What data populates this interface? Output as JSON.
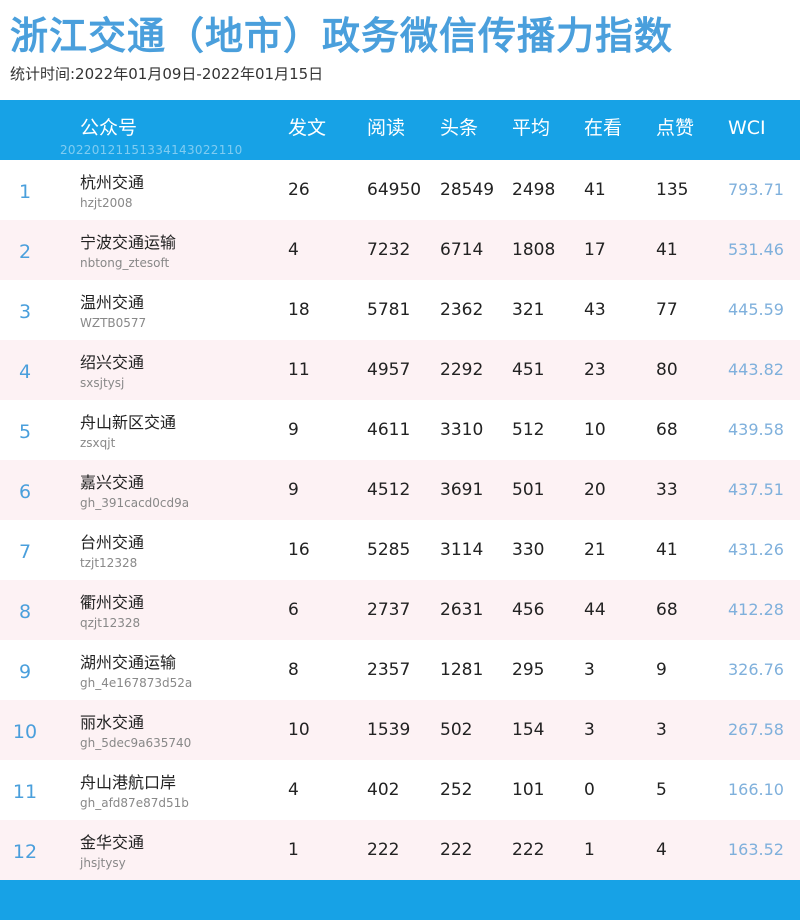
{
  "title": "浙江交通（地市）政务微信传播力指数",
  "subtitle": "统计时间:2022年01月09日-2022年01月15日",
  "header": {
    "account": "公众号",
    "posts": "发文",
    "reads": "阅读",
    "top": "头条",
    "avg": "平均",
    "watching": "在看",
    "likes": "点赞",
    "wci": "WCI",
    "watermark": "20220121151334143022110"
  },
  "rows": [
    {
      "rank": "1",
      "name": "杭州交通",
      "account": "hzjt2008",
      "posts": "26",
      "reads": "64950",
      "top": "28549",
      "avg": "2498",
      "watching": "41",
      "likes": "135",
      "wci": "793.71"
    },
    {
      "rank": "2",
      "name": "宁波交通运输",
      "account": "nbtong_ztesoft",
      "posts": "4",
      "reads": "7232",
      "top": "6714",
      "avg": "1808",
      "watching": "17",
      "likes": "41",
      "wci": "531.46"
    },
    {
      "rank": "3",
      "name": "温州交通",
      "account": "WZTB0577",
      "posts": "18",
      "reads": "5781",
      "top": "2362",
      "avg": "321",
      "watching": "43",
      "likes": "77",
      "wci": "445.59"
    },
    {
      "rank": "4",
      "name": "绍兴交通",
      "account": "sxsjtysj",
      "posts": "11",
      "reads": "4957",
      "top": "2292",
      "avg": "451",
      "watching": "23",
      "likes": "80",
      "wci": "443.82"
    },
    {
      "rank": "5",
      "name": "舟山新区交通",
      "account": "zsxqjt",
      "posts": "9",
      "reads": "4611",
      "top": "3310",
      "avg": "512",
      "watching": "10",
      "likes": "68",
      "wci": "439.58"
    },
    {
      "rank": "6",
      "name": "嘉兴交通",
      "account": "gh_391cacd0cd9a",
      "posts": "9",
      "reads": "4512",
      "top": "3691",
      "avg": "501",
      "watching": "20",
      "likes": "33",
      "wci": "437.51"
    },
    {
      "rank": "7",
      "name": "台州交通",
      "account": "tzjt12328",
      "posts": "16",
      "reads": "5285",
      "top": "3114",
      "avg": "330",
      "watching": "21",
      "likes": "41",
      "wci": "431.26"
    },
    {
      "rank": "8",
      "name": "衢州交通",
      "account": "qzjt12328",
      "posts": "6",
      "reads": "2737",
      "top": "2631",
      "avg": "456",
      "watching": "44",
      "likes": "68",
      "wci": "412.28"
    },
    {
      "rank": "9",
      "name": "湖州交通运输",
      "account": "gh_4e167873d52a",
      "posts": "8",
      "reads": "2357",
      "top": "1281",
      "avg": "295",
      "watching": "3",
      "likes": "9",
      "wci": "326.76"
    },
    {
      "rank": "10",
      "name": "丽水交通",
      "account": "gh_5dec9a635740",
      "posts": "10",
      "reads": "1539",
      "top": "502",
      "avg": "154",
      "watching": "3",
      "likes": "3",
      "wci": "267.58"
    },
    {
      "rank": "11",
      "name": "舟山港航口岸",
      "account": "gh_afd87e87d51b",
      "posts": "4",
      "reads": "402",
      "top": "252",
      "avg": "101",
      "watching": "0",
      "likes": "5",
      "wci": "166.10"
    },
    {
      "rank": "12",
      "name": "金华交通",
      "account": "jhsjtysy",
      "posts": "1",
      "reads": "222",
      "top": "222",
      "avg": "222",
      "watching": "1",
      "likes": "4",
      "wci": "163.52"
    }
  ],
  "colors": {
    "accent": "#17a2e6",
    "title": "#4a9fdc",
    "wci": "#7fb0dc",
    "stripe": "#fdf2f4"
  }
}
